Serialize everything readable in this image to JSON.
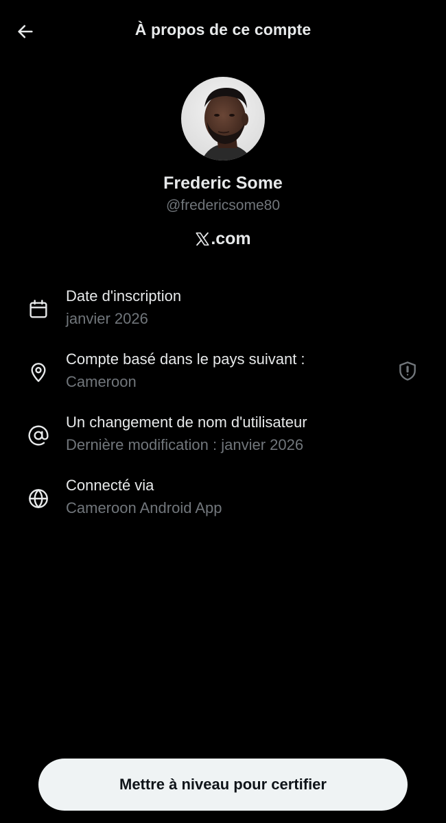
{
  "header": {
    "title": "À propos de ce compte",
    "back_icon": "arrow-left-icon"
  },
  "profile": {
    "name": "Frederic Some",
    "handle": "@fredericsome80",
    "site_logo": "X",
    "site_suffix": ".com"
  },
  "info_rows": [
    {
      "icon": "calendar-icon",
      "title": "Date d'inscription",
      "subtitle": "janvier 2026"
    },
    {
      "icon": "location-pin-icon",
      "title": "Compte basé dans le pays suivant :",
      "subtitle": "Cameroon",
      "trailing_icon": "shield-alert-icon"
    },
    {
      "icon": "at-sign-icon",
      "title": "Un changement de nom d'utilisateur",
      "subtitle": "Dernière modification : janvier 2026"
    },
    {
      "icon": "globe-icon",
      "title": "Connecté via",
      "subtitle": "Cameroon Android App"
    }
  ],
  "cta": {
    "label": "Mettre à niveau pour certifier"
  },
  "colors": {
    "background": "#000000",
    "primary_text": "#e7e9ea",
    "secondary_text": "#71767b",
    "button_bg": "#eff3f4",
    "button_text": "#0f1419"
  }
}
